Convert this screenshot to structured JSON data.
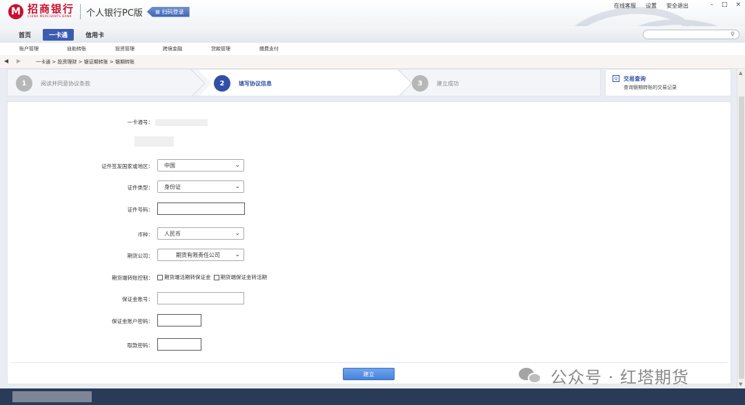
{
  "header": {
    "logo_mark": "M",
    "logo_cn": "招商银行",
    "logo_en": "CHINA MERCHANTS BANK",
    "app_title": "个人银行PC版",
    "scan_login": "扫码登录",
    "links": [
      "在线客服",
      "设置",
      "安全退出"
    ],
    "window_controls": [
      "–",
      "□",
      "×"
    ]
  },
  "nav": {
    "tabs": [
      {
        "label": "首页",
        "active": false
      },
      {
        "label": "一卡通",
        "active": true
      },
      {
        "label": "信用卡",
        "active": false
      }
    ],
    "search_placeholder": ""
  },
  "menu": [
    "账户管理",
    "自助转账",
    "投资管理",
    "跨境金融",
    "贷款管理",
    "缴费支付"
  ],
  "breadcrumb": {
    "back": "◀",
    "forward": "▶",
    "path": "一卡通 > 投资理财 > 银证期转账 > 银期转账"
  },
  "steps": [
    {
      "num": "1",
      "label": "阅读并同意协议条款",
      "active": false
    },
    {
      "num": "2",
      "label": "填写协议信息",
      "active": true
    },
    {
      "num": "3",
      "label": "建立成功",
      "active": false
    }
  ],
  "query": {
    "icon": "Q",
    "title": "交易查询",
    "desc": "查询银期转账的交易记录"
  },
  "form": {
    "card_label": "一卡通号：",
    "country_label": "证件签发国家或地区：",
    "country_value": "中国",
    "idtype_label": "证件类型：",
    "idtype_value": "身份证",
    "idnum_label": "证件号码：",
    "currency_label": "币种：",
    "currency_value": "人民币",
    "company_label": "期货公司：",
    "company_value": "期货有限责任公司",
    "transfer_ctrl_label": "期货端转账控制：",
    "check1": "期货端活期转保证金",
    "check2": "期货端保证金转活期",
    "margin_acct_label": "保证金账号：",
    "margin_pwd_label": "保证金账户密码：",
    "withdraw_pwd_label": "取款密码：",
    "submit": "建立"
  },
  "watermark": "公众号 · 红塔期货"
}
